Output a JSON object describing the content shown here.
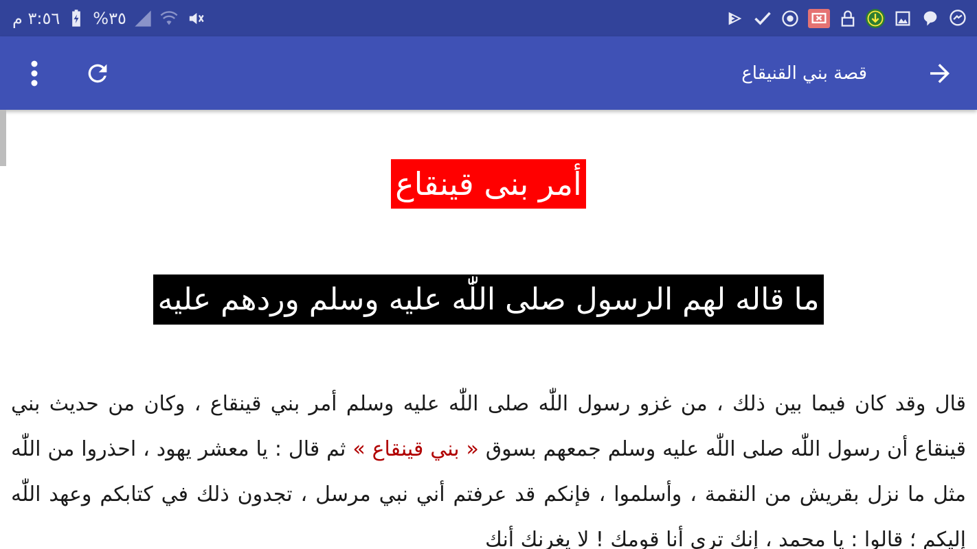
{
  "status_bar": {
    "time": "٣:٥٦ م",
    "battery": "%٣٥",
    "icons": [
      "messenger-icon",
      "chat-icon",
      "gallery-icon",
      "download-icon",
      "lock-icon",
      "screen-mirror-icon",
      "sync-icon",
      "check-icon",
      "play-store-icon",
      "mute-icon",
      "wifi-icon",
      "signal-icon",
      "battery-charging-icon"
    ]
  },
  "app_bar": {
    "title": "قصة بني القنيقاع",
    "back_icon": "arrow-right-icon",
    "refresh_icon": "refresh-icon",
    "menu_icon": "more-vert-icon"
  },
  "article": {
    "heading": "أمر بنى قينقاع",
    "subheading": "ما قاله لهم الرسول صلى اللّٰه عليه وسلم وردهم عليه",
    "paragraph": {
      "part1": "قال وقد كان فيما بين ذلك ، من غزو رسول اللّٰه صلى اللّٰه عليه وسلم أمر بني قينقاع ، وكان من حديث بني قينقاع أن رسول اللّٰه صلى اللّٰه عليه وسلم جمعهم بسوق ",
      "highlight": "« بني قينقاع »",
      "part2": " ثم قال : يا معشر يهود ، احذروا من اللّٰه مثل ما نزل بقريش من النقمة ، وأسلموا ، فإنكم قد عرفتم أني نبي مرسل ، تجدون ذلك في كتابكم وعهد اللّٰه إليكم ؛ قالوا : يا محمد ، إنك ترى أنا قومك ! لا يغرنك أنك"
    },
    "colors": {
      "heading_bg": "#ff0000",
      "subheading_bg": "#000000",
      "highlight": "#b00000"
    }
  },
  "colors": {
    "status_bar": "#32439a",
    "app_bar": "#3f51b5"
  }
}
